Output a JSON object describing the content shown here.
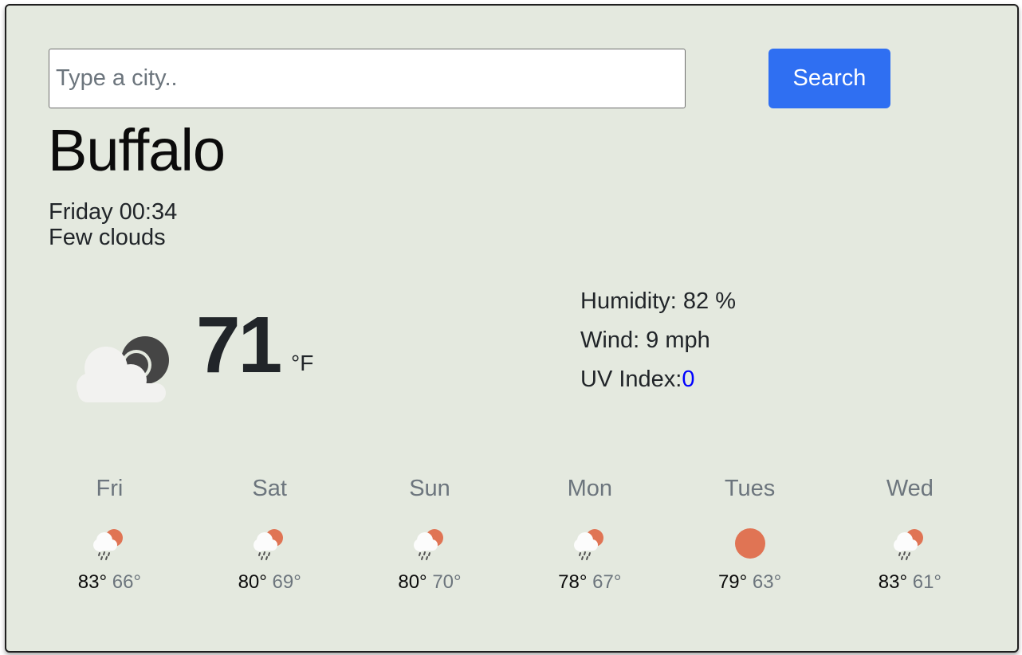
{
  "search": {
    "placeholder": "Type a city..",
    "value": "",
    "button_label": "Search"
  },
  "current": {
    "city": "Buffalo",
    "datetime": "Friday 00:34",
    "description": "Few clouds",
    "temperature": "71",
    "unit": "°F",
    "icon": "cloud-moon-icon"
  },
  "details": {
    "humidity": "Humidity: 82 %",
    "wind": "Wind: 9 mph",
    "uv_label": "UV Index:",
    "uv_value": "0"
  },
  "colors": {
    "background": "#e4e9df",
    "accent": "#2f6ff2",
    "uv_value": "#0000ff",
    "sun": "#e07454",
    "muted": "#6c757d"
  },
  "forecast": [
    {
      "day": "Fri",
      "high": "83°",
      "low": "66°",
      "icon": "rain-sun-icon"
    },
    {
      "day": "Sat",
      "high": "80°",
      "low": "69°",
      "icon": "rain-sun-icon"
    },
    {
      "day": "Sun",
      "high": "80°",
      "low": "70°",
      "icon": "rain-sun-icon"
    },
    {
      "day": "Mon",
      "high": "78°",
      "low": "67°",
      "icon": "rain-sun-icon"
    },
    {
      "day": "Tues",
      "high": "79°",
      "low": "63°",
      "icon": "sun-icon"
    },
    {
      "day": "Wed",
      "high": "83°",
      "low": "61°",
      "icon": "rain-sun-icon"
    }
  ]
}
